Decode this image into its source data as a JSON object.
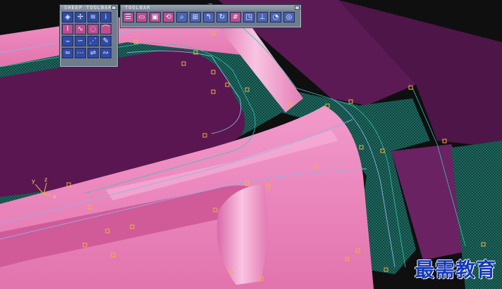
{
  "colors": {
    "background": "#0f0f10",
    "surface_pink": "#e97bb4",
    "surface_purple": "#5c1a55",
    "mesh_green": "#144b45",
    "cv_points": "#f0b040",
    "toolbar_blue": "#2f4aa8",
    "toolbar_pink": "#c04b8e",
    "watermark": "#1538b8"
  },
  "toolbars": {
    "sheep": {
      "title": "SHEEP TOOLBAR",
      "buttons": [
        {
          "icon": "pick-surface-icon",
          "glyph": "◈",
          "style": "blue"
        },
        {
          "icon": "surface-tools-icon",
          "glyph": "✢",
          "style": "blue"
        },
        {
          "icon": "layers-icon",
          "glyph": "≋",
          "style": "blue"
        },
        {
          "icon": "info-icon",
          "glyph": "i",
          "style": "blue"
        },
        {
          "icon": "edit-curve-icon",
          "glyph": "⌇",
          "style": "pink"
        },
        {
          "icon": "wave-curve-icon",
          "glyph": "∿",
          "style": "pink"
        },
        {
          "icon": "lasso-curve-icon",
          "glyph": "◌",
          "style": "pink"
        },
        {
          "icon": "blend-curve-icon",
          "glyph": "⌒",
          "style": "pink"
        },
        {
          "icon": "curve-on-surface-icon",
          "glyph": "⌣",
          "style": "blue"
        },
        {
          "icon": "spline-icon",
          "glyph": "∽",
          "style": "blue"
        },
        {
          "icon": "trim-icon",
          "glyph": "⋰",
          "style": "blue"
        },
        {
          "icon": "rebuild-icon",
          "glyph": "✎",
          "style": "blue"
        },
        {
          "icon": "loft-icon",
          "glyph": "≈",
          "style": "blue"
        },
        {
          "icon": "rail-icon",
          "glyph": "⋯",
          "style": "blue"
        },
        {
          "icon": "offset-icon",
          "glyph": "⇌",
          "style": "blue"
        },
        {
          "icon": "fillet-icon",
          "glyph": "∾",
          "style": "blue"
        }
      ]
    },
    "view": {
      "title": "TOOLBAR",
      "buttons": [
        {
          "icon": "align-left-icon",
          "glyph": "☰",
          "style": "pink"
        },
        {
          "icon": "window-icon",
          "glyph": "▭",
          "style": "pink"
        },
        {
          "icon": "cube-icon",
          "glyph": "▣",
          "style": "pink"
        },
        {
          "icon": "tumble-icon",
          "glyph": "⟲",
          "style": "pink"
        },
        {
          "icon": "magnify-icon",
          "glyph": "⌕",
          "style": "pale"
        },
        {
          "icon": "fit-view-icon",
          "glyph": "⊞",
          "style": "pale"
        },
        {
          "icon": "track-icon",
          "glyph": "↰",
          "style": "pale"
        },
        {
          "icon": "rotate-view-icon",
          "glyph": "↻",
          "style": "pale"
        },
        {
          "icon": "grid-icon",
          "glyph": "#",
          "style": "pink"
        },
        {
          "icon": "frame-icon",
          "glyph": "◳",
          "style": "pale"
        },
        {
          "icon": "axis-icon",
          "glyph": "⊥",
          "style": "pale"
        },
        {
          "icon": "shade-icon",
          "glyph": "◔",
          "style": "pale"
        },
        {
          "icon": "refresh-icon",
          "glyph": "◎",
          "style": "pale"
        }
      ]
    }
  },
  "viewport": {
    "axis_label_x": "x",
    "axis_label_y": "y",
    "axis_label_z": "z"
  },
  "watermark": "最需教育"
}
